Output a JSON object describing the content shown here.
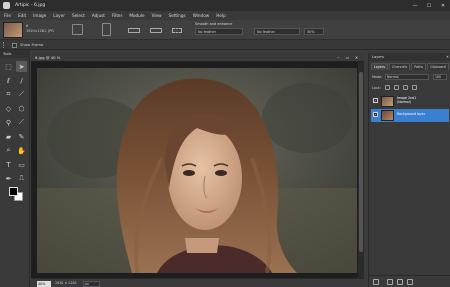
{
  "window": {
    "title": "Artipic - 6.jpg",
    "minimize": "—",
    "maximize": "☐",
    "close": "✕"
  },
  "menu": [
    "File",
    "Edit",
    "Image",
    "Layer",
    "Select",
    "Adjust",
    "Filter",
    "Module",
    "View",
    "Settings",
    "Window",
    "Help"
  ],
  "options": {
    "doc_name": "6",
    "doc_dims": "1920×1281, JPG",
    "label": "Smooth and enhance",
    "select1": "No feather",
    "select2": "No feather",
    "select3": "30%"
  },
  "docbar": {
    "show_preset": "Show Frame"
  },
  "toolbox": {
    "header": "Tools"
  },
  "document": {
    "tab_title": "6.jpg @ 40 %",
    "zoom": "40%",
    "dims": "1920 × 1281",
    "unit": "px"
  },
  "layers_panel": {
    "title": "Layers",
    "tabs": [
      "Layers",
      "Channels",
      "Paths",
      "Clipboard"
    ],
    "mode_label": "Mode:",
    "mode_value": "Normal",
    "opacity_value": "100",
    "lock_label": "Lock:",
    "layers": [
      {
        "name": "Image 2nd1",
        "sub": "(Normal)",
        "visible": true,
        "selected": false
      },
      {
        "name": "Background layer",
        "sub": "",
        "visible": true,
        "selected": true
      }
    ]
  },
  "colors": {
    "accent": "#3b7fd1",
    "chrome": "#3a3a3a",
    "canvas_bg": "#1e1e1e"
  },
  "icons": [
    "marquee-icon",
    "move-icon",
    "lasso-icon",
    "brush-icon",
    "crop-icon",
    "eyedropper-icon",
    "eraser-icon",
    "stamp-icon",
    "heal-icon",
    "bucket-icon",
    "gradient-icon",
    "dodge-icon",
    "zoom-icon",
    "hand-icon",
    "text-icon",
    "shape-icon",
    "pen-icon",
    "measure-icon"
  ]
}
